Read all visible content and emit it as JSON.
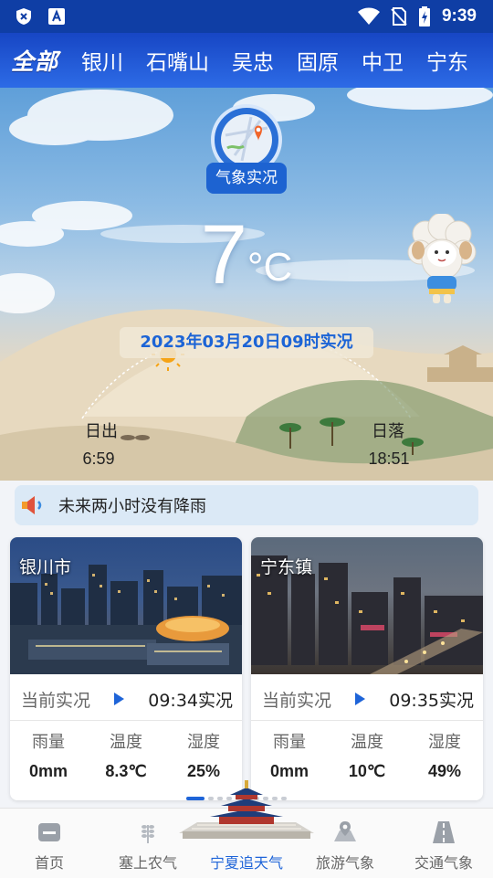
{
  "status_bar": {
    "time": "9:39",
    "left_icons": [
      "shield-x-icon",
      "font-a-icon"
    ],
    "right_icons": [
      "wifi-icon",
      "no-sim-icon",
      "battery-charging-icon"
    ]
  },
  "city_tabs": [
    {
      "label": "全部",
      "active": true
    },
    {
      "label": "银川",
      "active": false
    },
    {
      "label": "石嘴山",
      "active": false
    },
    {
      "label": "吴忠",
      "active": false
    },
    {
      "label": "固原",
      "active": false
    },
    {
      "label": "中卫",
      "active": false
    },
    {
      "label": "宁东",
      "active": false
    }
  ],
  "hero": {
    "badge_label": "气象实况",
    "temperature": "7",
    "temperature_unit": "°C",
    "observation_time": "2023年03月20日09时实况",
    "sunrise_label": "日出",
    "sunrise_time": "6:59",
    "sunset_label": "日落",
    "sunset_time": "18:51"
  },
  "notice": {
    "icon": "speaker-icon",
    "text": "未来两小时没有降雨"
  },
  "stations": [
    {
      "name": "银川市",
      "current_label": "当前实况",
      "time": "09:34实况",
      "metrics": [
        {
          "label": "雨量",
          "value": "0mm"
        },
        {
          "label": "温度",
          "value": "8.3℃"
        },
        {
          "label": "湿度",
          "value": "25%"
        }
      ]
    },
    {
      "name": "宁东镇",
      "current_label": "当前实况",
      "time": "09:35实况",
      "metrics": [
        {
          "label": "雨量",
          "value": "0mm"
        },
        {
          "label": "温度",
          "value": "10℃"
        },
        {
          "label": "湿度",
          "value": "49%"
        }
      ]
    }
  ],
  "bottom_nav": [
    {
      "label": "首页",
      "icon": "home-icon",
      "active": false
    },
    {
      "label": "塞上农气",
      "icon": "wheat-icon",
      "active": false
    },
    {
      "label": "宁夏追天气",
      "icon": "temple-icon",
      "active": true
    },
    {
      "label": "旅游气象",
      "icon": "map-pin-icon",
      "active": false
    },
    {
      "label": "交通气象",
      "icon": "road-icon",
      "active": false
    }
  ],
  "colors": {
    "header_blue": "#1746c4",
    "accent_blue": "#1e64d8",
    "notice_bg": "#dbe9f6"
  }
}
